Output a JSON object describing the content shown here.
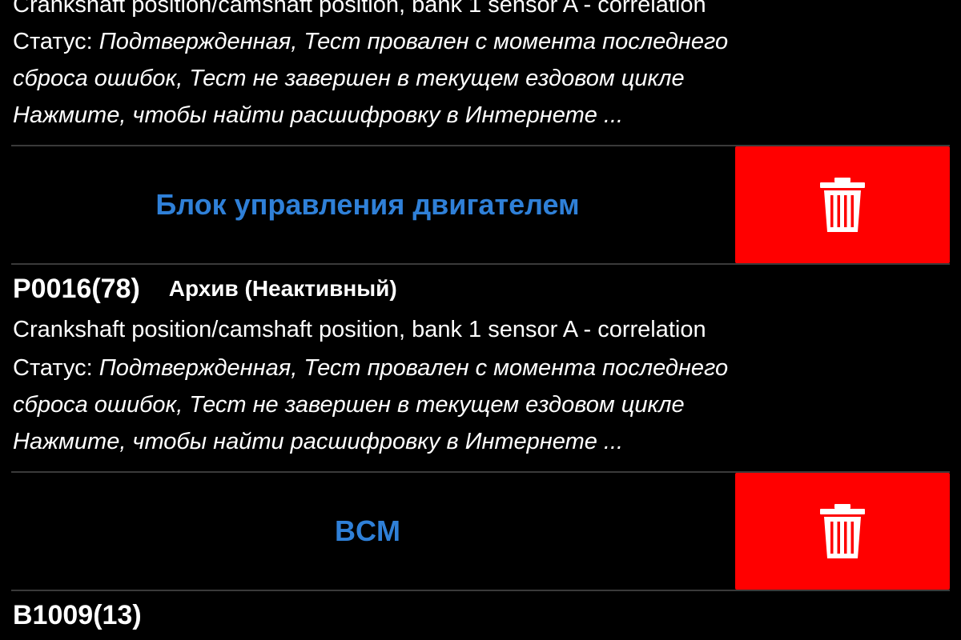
{
  "colors": {
    "background": "#000000",
    "text": "#ffffff",
    "accent_blue": "#2f80d8",
    "delete_red": "#ff0000",
    "divider": "#3a3a3a"
  },
  "entries": [
    {
      "description": "Crankshaft position/camshaft position, bank 1 sensor A - correlation",
      "status_prefix": "Статус: ",
      "status_line1": "Подтвержденная, Тест провален с момента последнего",
      "status_line2": "сброса ошибок, Тест не завершен в текущем ездовом цикле",
      "search_hint": "Нажмите, чтобы найти расшифровку в Интернете ..."
    },
    {
      "ecu_title": "Блок управления двигателем",
      "delete_icon": "trash-icon",
      "code": "P0016(78)",
      "archive_label": "Архив (Неактивный)",
      "description": "Crankshaft position/camshaft position, bank 1 sensor A - correlation",
      "status_prefix": "Статус: ",
      "status_line1": "Подтвержденная, Тест провален с момента последнего",
      "status_line2": "сброса ошибок, Тест не завершен в текущем ездовом цикле",
      "search_hint": "Нажмите, чтобы найти расшифровку в Интернете ..."
    },
    {
      "ecu_title": "BCM",
      "delete_icon": "trash-icon",
      "code": "B1009(13)"
    }
  ]
}
